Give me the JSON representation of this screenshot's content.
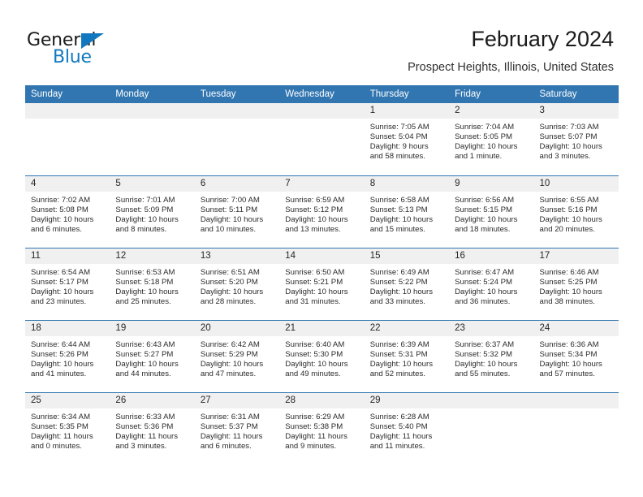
{
  "brand": {
    "name_top": "General",
    "name_bottom": "Blue",
    "triangle_color": "#1178c0",
    "text_color": "#1b1b1b"
  },
  "header": {
    "title": "February 2024",
    "subtitle": "Prospect Heights, Illinois, United States",
    "accent_color": "#3276b1"
  },
  "calendar": {
    "weekday_headers": [
      "Sunday",
      "Monday",
      "Tuesday",
      "Wednesday",
      "Thursday",
      "Friday",
      "Saturday"
    ],
    "header_bg": "#3276b1",
    "header_text": "#ffffff",
    "daynum_bg": "#f0f0f0",
    "weeks": [
      [
        {
          "day": "",
          "sunrise": "",
          "sunset": "",
          "daylight_line1": "",
          "daylight_line2": ""
        },
        {
          "day": "",
          "sunrise": "",
          "sunset": "",
          "daylight_line1": "",
          "daylight_line2": ""
        },
        {
          "day": "",
          "sunrise": "",
          "sunset": "",
          "daylight_line1": "",
          "daylight_line2": ""
        },
        {
          "day": "",
          "sunrise": "",
          "sunset": "",
          "daylight_line1": "",
          "daylight_line2": ""
        },
        {
          "day": "1",
          "sunrise": "Sunrise: 7:05 AM",
          "sunset": "Sunset: 5:04 PM",
          "daylight_line1": "Daylight: 9 hours",
          "daylight_line2": "and 58 minutes."
        },
        {
          "day": "2",
          "sunrise": "Sunrise: 7:04 AM",
          "sunset": "Sunset: 5:05 PM",
          "daylight_line1": "Daylight: 10 hours",
          "daylight_line2": "and 1 minute."
        },
        {
          "day": "3",
          "sunrise": "Sunrise: 7:03 AM",
          "sunset": "Sunset: 5:07 PM",
          "daylight_line1": "Daylight: 10 hours",
          "daylight_line2": "and 3 minutes."
        }
      ],
      [
        {
          "day": "4",
          "sunrise": "Sunrise: 7:02 AM",
          "sunset": "Sunset: 5:08 PM",
          "daylight_line1": "Daylight: 10 hours",
          "daylight_line2": "and 6 minutes."
        },
        {
          "day": "5",
          "sunrise": "Sunrise: 7:01 AM",
          "sunset": "Sunset: 5:09 PM",
          "daylight_line1": "Daylight: 10 hours",
          "daylight_line2": "and 8 minutes."
        },
        {
          "day": "6",
          "sunrise": "Sunrise: 7:00 AM",
          "sunset": "Sunset: 5:11 PM",
          "daylight_line1": "Daylight: 10 hours",
          "daylight_line2": "and 10 minutes."
        },
        {
          "day": "7",
          "sunrise": "Sunrise: 6:59 AM",
          "sunset": "Sunset: 5:12 PM",
          "daylight_line1": "Daylight: 10 hours",
          "daylight_line2": "and 13 minutes."
        },
        {
          "day": "8",
          "sunrise": "Sunrise: 6:58 AM",
          "sunset": "Sunset: 5:13 PM",
          "daylight_line1": "Daylight: 10 hours",
          "daylight_line2": "and 15 minutes."
        },
        {
          "day": "9",
          "sunrise": "Sunrise: 6:56 AM",
          "sunset": "Sunset: 5:15 PM",
          "daylight_line1": "Daylight: 10 hours",
          "daylight_line2": "and 18 minutes."
        },
        {
          "day": "10",
          "sunrise": "Sunrise: 6:55 AM",
          "sunset": "Sunset: 5:16 PM",
          "daylight_line1": "Daylight: 10 hours",
          "daylight_line2": "and 20 minutes."
        }
      ],
      [
        {
          "day": "11",
          "sunrise": "Sunrise: 6:54 AM",
          "sunset": "Sunset: 5:17 PM",
          "daylight_line1": "Daylight: 10 hours",
          "daylight_line2": "and 23 minutes."
        },
        {
          "day": "12",
          "sunrise": "Sunrise: 6:53 AM",
          "sunset": "Sunset: 5:18 PM",
          "daylight_line1": "Daylight: 10 hours",
          "daylight_line2": "and 25 minutes."
        },
        {
          "day": "13",
          "sunrise": "Sunrise: 6:51 AM",
          "sunset": "Sunset: 5:20 PM",
          "daylight_line1": "Daylight: 10 hours",
          "daylight_line2": "and 28 minutes."
        },
        {
          "day": "14",
          "sunrise": "Sunrise: 6:50 AM",
          "sunset": "Sunset: 5:21 PM",
          "daylight_line1": "Daylight: 10 hours",
          "daylight_line2": "and 31 minutes."
        },
        {
          "day": "15",
          "sunrise": "Sunrise: 6:49 AM",
          "sunset": "Sunset: 5:22 PM",
          "daylight_line1": "Daylight: 10 hours",
          "daylight_line2": "and 33 minutes."
        },
        {
          "day": "16",
          "sunrise": "Sunrise: 6:47 AM",
          "sunset": "Sunset: 5:24 PM",
          "daylight_line1": "Daylight: 10 hours",
          "daylight_line2": "and 36 minutes."
        },
        {
          "day": "17",
          "sunrise": "Sunrise: 6:46 AM",
          "sunset": "Sunset: 5:25 PM",
          "daylight_line1": "Daylight: 10 hours",
          "daylight_line2": "and 38 minutes."
        }
      ],
      [
        {
          "day": "18",
          "sunrise": "Sunrise: 6:44 AM",
          "sunset": "Sunset: 5:26 PM",
          "daylight_line1": "Daylight: 10 hours",
          "daylight_line2": "and 41 minutes."
        },
        {
          "day": "19",
          "sunrise": "Sunrise: 6:43 AM",
          "sunset": "Sunset: 5:27 PM",
          "daylight_line1": "Daylight: 10 hours",
          "daylight_line2": "and 44 minutes."
        },
        {
          "day": "20",
          "sunrise": "Sunrise: 6:42 AM",
          "sunset": "Sunset: 5:29 PM",
          "daylight_line1": "Daylight: 10 hours",
          "daylight_line2": "and 47 minutes."
        },
        {
          "day": "21",
          "sunrise": "Sunrise: 6:40 AM",
          "sunset": "Sunset: 5:30 PM",
          "daylight_line1": "Daylight: 10 hours",
          "daylight_line2": "and 49 minutes."
        },
        {
          "day": "22",
          "sunrise": "Sunrise: 6:39 AM",
          "sunset": "Sunset: 5:31 PM",
          "daylight_line1": "Daylight: 10 hours",
          "daylight_line2": "and 52 minutes."
        },
        {
          "day": "23",
          "sunrise": "Sunrise: 6:37 AM",
          "sunset": "Sunset: 5:32 PM",
          "daylight_line1": "Daylight: 10 hours",
          "daylight_line2": "and 55 minutes."
        },
        {
          "day": "24",
          "sunrise": "Sunrise: 6:36 AM",
          "sunset": "Sunset: 5:34 PM",
          "daylight_line1": "Daylight: 10 hours",
          "daylight_line2": "and 57 minutes."
        }
      ],
      [
        {
          "day": "25",
          "sunrise": "Sunrise: 6:34 AM",
          "sunset": "Sunset: 5:35 PM",
          "daylight_line1": "Daylight: 11 hours",
          "daylight_line2": "and 0 minutes."
        },
        {
          "day": "26",
          "sunrise": "Sunrise: 6:33 AM",
          "sunset": "Sunset: 5:36 PM",
          "daylight_line1": "Daylight: 11 hours",
          "daylight_line2": "and 3 minutes."
        },
        {
          "day": "27",
          "sunrise": "Sunrise: 6:31 AM",
          "sunset": "Sunset: 5:37 PM",
          "daylight_line1": "Daylight: 11 hours",
          "daylight_line2": "and 6 minutes."
        },
        {
          "day": "28",
          "sunrise": "Sunrise: 6:29 AM",
          "sunset": "Sunset: 5:38 PM",
          "daylight_line1": "Daylight: 11 hours",
          "daylight_line2": "and 9 minutes."
        },
        {
          "day": "29",
          "sunrise": "Sunrise: 6:28 AM",
          "sunset": "Sunset: 5:40 PM",
          "daylight_line1": "Daylight: 11 hours",
          "daylight_line2": "and 11 minutes."
        },
        {
          "day": "",
          "sunrise": "",
          "sunset": "",
          "daylight_line1": "",
          "daylight_line2": ""
        },
        {
          "day": "",
          "sunrise": "",
          "sunset": "",
          "daylight_line1": "",
          "daylight_line2": ""
        }
      ]
    ]
  }
}
